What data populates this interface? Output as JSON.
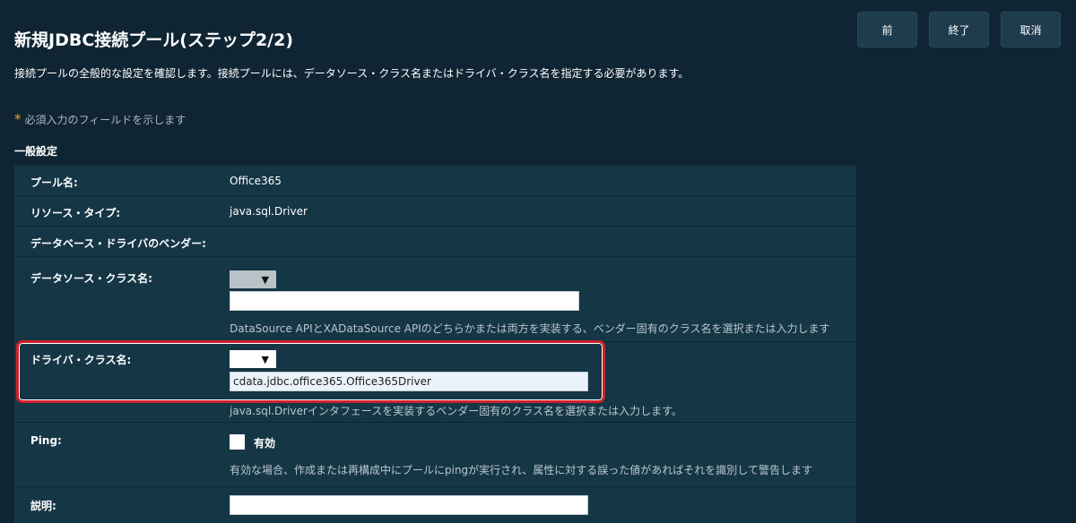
{
  "header": {
    "title": "新規JDBC接続プール(ステップ2/2)",
    "buttons": {
      "prev": "前",
      "finish": "終了",
      "cancel": "取消"
    }
  },
  "intro": "接続プールの全般的な設定を確認します。接続プールには、データソース・クラス名またはドライバ・クラス名を指定する必要があります。",
  "required_note": {
    "star": "*",
    "text": "必須入力のフィールドを示します"
  },
  "section": "一般設定",
  "fields": {
    "pool_name": {
      "label": "プール名:",
      "value": "Office365"
    },
    "resource_type": {
      "label": "リソース・タイプ:",
      "value": "java.sql.Driver"
    },
    "vendor": {
      "label": "データベース・ドライバのベンダー:"
    },
    "datasource_class": {
      "label": "データソース・クラス名:",
      "select_arrow": "▼",
      "value": "",
      "help": "DataSource APIとXADataSource APIのどちらかまたは両方を実装する、ベンダー固有のクラス名を選択または入力します"
    },
    "driver_class": {
      "label": "ドライバ・クラス名:",
      "select_arrow": "▼",
      "value": "cdata.jdbc.office365.Office365Driver",
      "help": "java.sql.Driverインタフェースを実装するベンダー固有のクラス名を選択または入力します。"
    },
    "ping": {
      "label": "Ping:",
      "checkbox_label": "有効",
      "checked": false,
      "help": "有効な場合、作成または再構成中にプールにpingが実行され、属性に対する誤った値があればそれを識別して警告します"
    },
    "description": {
      "label": "説明:",
      "value": ""
    }
  },
  "colors": {
    "background": "#0f2533",
    "panel": "#153645",
    "highlight": "#d0202a",
    "required_star": "#f0a823"
  }
}
